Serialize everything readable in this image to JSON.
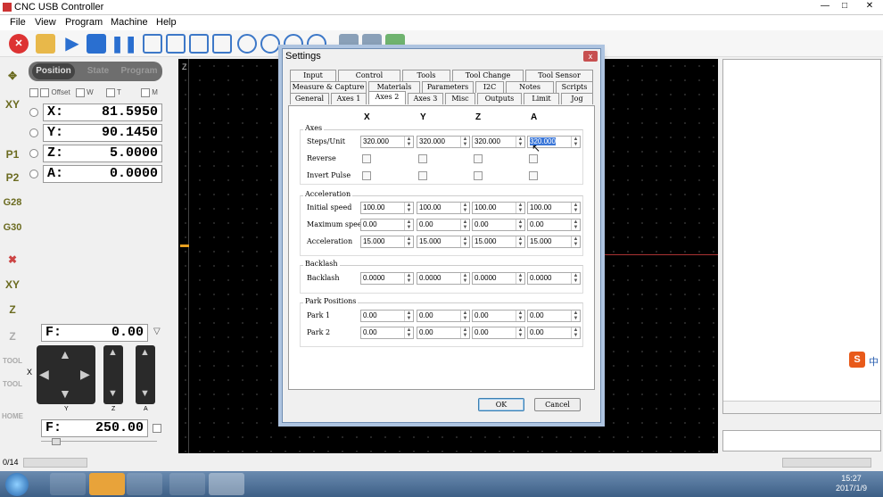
{
  "app": {
    "title": "CNC USB Controller"
  },
  "menus": [
    "File",
    "View",
    "Program",
    "Machine",
    "Help"
  ],
  "left": {
    "segments": [
      "Position",
      "State",
      "Program"
    ],
    "offset_row": [
      "Offset",
      "W",
      "T",
      "M"
    ],
    "side_buttons": [
      "XY",
      "P1",
      "P2",
      "G28",
      "G30",
      "XY",
      "Z",
      "Z",
      "TOOL",
      "TOOL",
      "HOME"
    ],
    "coords": [
      {
        "label": "X:",
        "value": "81.5950"
      },
      {
        "label": "Y:",
        "value": "90.1450"
      },
      {
        "label": "Z:",
        "value": "5.0000"
      },
      {
        "label": "A:",
        "value": "0.0000"
      }
    ],
    "feed": {
      "label": "F:",
      "value": "0.00"
    },
    "feed2": {
      "label": "F:",
      "value": "250.00"
    },
    "jog_labels": {
      "x": "X",
      "y": "Y",
      "z": "Z",
      "a": "A"
    },
    "viewport_axis_label": "Z"
  },
  "status": {
    "progress": "0/14"
  },
  "clock": {
    "time": "15:27",
    "date": "2017/1/9"
  },
  "dialog": {
    "title": "Settings",
    "close": "x",
    "tabs_row1": [
      "Input",
      "Control",
      "Tools",
      "Tool Change",
      "Tool Sensor"
    ],
    "tabs_row2": [
      "Measure & Capture",
      "Materials",
      "Parameters",
      "I2C",
      "Notes",
      "Scripts"
    ],
    "tabs_row3": [
      "General",
      "Axes 1",
      "Axes 2",
      "Axes 3",
      "Misc",
      "Outputs",
      "Limit",
      "Jog"
    ],
    "active_tab": "Axes 2",
    "columns": [
      "X",
      "Y",
      "Z",
      "A"
    ],
    "groups": {
      "axes": "Axes",
      "acceleration": "Acceleration",
      "backlash": "Backlash",
      "park": "Park Positions"
    },
    "rows": {
      "steps": {
        "label": "Steps/Unit",
        "values": [
          "320.000",
          "320.000",
          "320.000",
          "320.000"
        ]
      },
      "reverse": {
        "label": "Reverse"
      },
      "invert": {
        "label": "Invert Pulse"
      },
      "initial": {
        "label": "Initial speed",
        "values": [
          "100.00",
          "100.00",
          "100.00",
          "100.00"
        ]
      },
      "maximum": {
        "label": "Maximum speed",
        "values": [
          "0.00",
          "0.00",
          "0.00",
          "0.00"
        ]
      },
      "accel": {
        "label": "Acceleration",
        "values": [
          "15.000",
          "15.000",
          "15.000",
          "15.000"
        ]
      },
      "backlash": {
        "label": "Backlash",
        "values": [
          "0.0000",
          "0.0000",
          "0.0000",
          "0.0000"
        ]
      },
      "park1": {
        "label": "Park 1",
        "values": [
          "0.00",
          "0.00",
          "0.00",
          "0.00"
        ]
      },
      "park2": {
        "label": "Park 2",
        "values": [
          "0.00",
          "0.00",
          "0.00",
          "0.00"
        ]
      }
    },
    "ok": "OK",
    "cancel": "Cancel"
  },
  "ime": {
    "label": "中"
  }
}
